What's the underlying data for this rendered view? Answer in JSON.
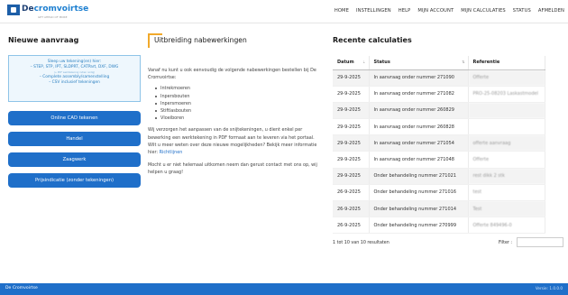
{
  "header": {
    "logo_de": "De",
    "logo_brand": "cromvoirtse",
    "logo_tagline": "GET AHEAD OF MORE",
    "nav": [
      "HOME",
      "INSTELLINGEN",
      "HELP",
      "MIJN ACCOUNT",
      "MIJN CALCULATIES",
      "STATUS",
      "AFMELDEN"
    ]
  },
  "left": {
    "title": "Nieuwe aanvraag",
    "dropzone": {
      "line1": "Sleep uw tekening(en) hier:",
      "line2": "– STEP, STP, IPT, SLDPRT, CATPart, DXF, DWG",
      "small": "(+ PDF werktekening indien nodig)",
      "line3": "– Complete assembly/samenstelling",
      "line4": "– CSV inclusief tekeningen"
    },
    "buttons": [
      "Online CAD tekenen",
      "Handel",
      "Zaagwerk",
      "Prijsindicatie (zonder tekeningen)"
    ]
  },
  "middle": {
    "title": "Uitbreiding nabewerkingen",
    "intro": "Vanaf nu kunt u ook eenvoudig de volgende nabewerkingen bestellen bij De Cromvoirtse:",
    "bullets": [
      "Intrekmoeren",
      "Inpersbouten",
      "Inpersmoeren",
      "Stiftlasbouten",
      "Vloeiboren"
    ],
    "para2": "Wij verzorgen het aanpassen van de snijtekeningen, u dient enkel per bewerking een werktekening in PDF formaat aan te leveren via het portaal. Wilt u meer weten over deze nieuwe mogelijkheden? Bekijk meer informatie hier:",
    "para2_link": "Richtlijnen",
    "para3": "Mocht u er niet helemaal uitkomen neem dan gerust contact met ons op, wij helpen u graag!"
  },
  "right": {
    "title": "Recente calculaties",
    "columns": [
      "Datum",
      "Status",
      "Referentie"
    ],
    "rows": [
      {
        "date": "29-9-2025",
        "status": "In aanvraag onder nummer 271090",
        "ref": "Offerte"
      },
      {
        "date": "29-9-2025",
        "status": "In aanvraag onder nummer 271082",
        "ref": "PRO-25-08203 Laskastmodel"
      },
      {
        "date": "29-9-2025",
        "status": "In aanvraag onder nummer 260829",
        "ref": ""
      },
      {
        "date": "29-9-2025",
        "status": "In aanvraag onder nummer 260828",
        "ref": ""
      },
      {
        "date": "29-9-2025",
        "status": "In aanvraag onder nummer 271054",
        "ref": "offerte aanvraag"
      },
      {
        "date": "29-9-2025",
        "status": "In aanvraag onder nummer 271048",
        "ref": "Offerte"
      },
      {
        "date": "29-9-2025",
        "status": "Onder behandeling nummer 271021",
        "ref": "rest dikk 2 stk"
      },
      {
        "date": "26-9-2025",
        "status": "Onder behandeling nummer 271016",
        "ref": "test"
      },
      {
        "date": "26-9-2025",
        "status": "Onder behandeling nummer 271014",
        "ref": "Test"
      },
      {
        "date": "26-9-2025",
        "status": "Onder behandeling nummer 270999",
        "ref": "Offerte 849496-0"
      }
    ],
    "info": "1 tot 10 van 10 resultaten",
    "filter_label": "Filter :",
    "filter_value": ""
  },
  "footer": {
    "left": "De Cromvoirtse",
    "right": "Versie: 1.0.0.0"
  },
  "colors": {
    "accent": "#1f6fc9",
    "frame": "#f1a92b",
    "dropzone_bg": "#eef7fd"
  }
}
